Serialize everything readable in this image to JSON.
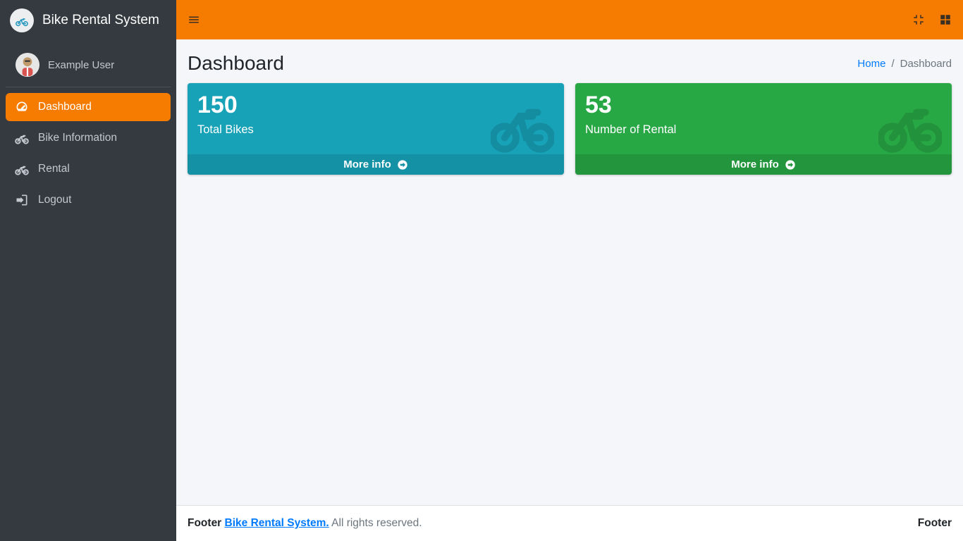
{
  "brand": {
    "title": "Bike Rental System"
  },
  "user": {
    "name": "Example User"
  },
  "sidebar": {
    "items": [
      {
        "label": "Dashboard",
        "active": true
      },
      {
        "label": "Bike Information",
        "active": false
      },
      {
        "label": "Rental",
        "active": false
      },
      {
        "label": "Logout",
        "active": false
      }
    ]
  },
  "header": {
    "title": "Dashboard",
    "breadcrumb": {
      "home": "Home",
      "current": "Dashboard"
    }
  },
  "cards": {
    "total_bikes": {
      "value": "150",
      "label": "Total Bikes",
      "more": "More info",
      "color": "teal"
    },
    "number_of_rental": {
      "value": "53",
      "label": "Number of Rental",
      "more": "More info",
      "color": "green"
    }
  },
  "footer": {
    "left_prefix": "Footer ",
    "brand_link": "Bike Rental System.",
    "left_suffix": " All rights reserved.",
    "right": "Footer"
  },
  "colors": {
    "accent": "#F57C00",
    "teal": "#17a2b8",
    "green": "#28a745",
    "link": "#007bff"
  }
}
